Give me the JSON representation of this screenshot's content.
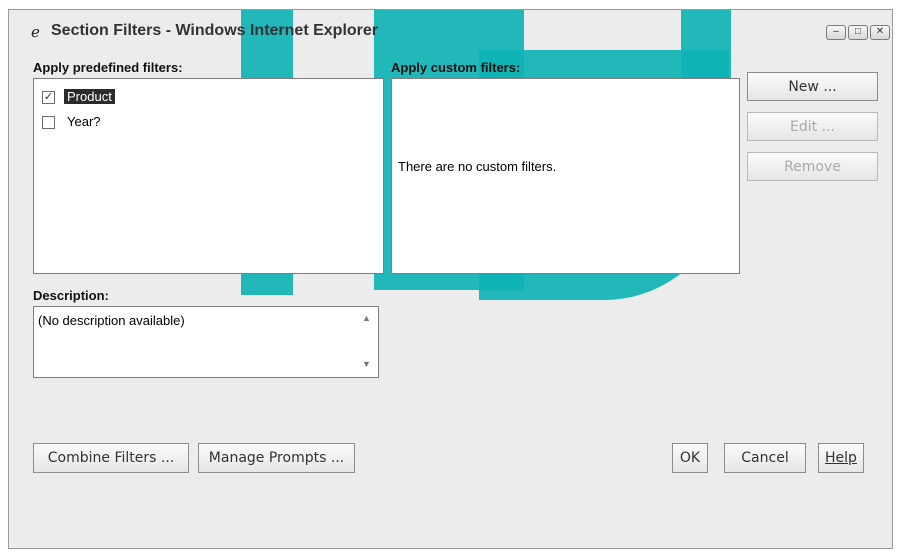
{
  "window": {
    "title": "Section Filters - Windows Internet Explorer",
    "icon": "ie-icon",
    "controls": [
      "minimize-icon",
      "maximize-icon",
      "close-icon"
    ]
  },
  "predefined": {
    "heading": "Apply predefined filters:",
    "items": [
      {
        "label": "Product",
        "checked": true,
        "selected": true
      },
      {
        "label": "Year?",
        "checked": false,
        "selected": false
      }
    ]
  },
  "custom": {
    "heading": "Apply custom filters:",
    "empty_text": "There are no custom filters.",
    "buttons": {
      "new": "New ...",
      "edit": "Edit ...",
      "remove": "Remove"
    }
  },
  "description": {
    "heading": "Description:",
    "text": "(No description available)"
  },
  "footer": {
    "combine": "Combine Filters ...",
    "manage": "Manage Prompts ...",
    "ok": "OK",
    "cancel": "Cancel",
    "help": "Help"
  },
  "colors": {
    "watermark": "#10b3b5",
    "selection": "#2b2b2b"
  }
}
